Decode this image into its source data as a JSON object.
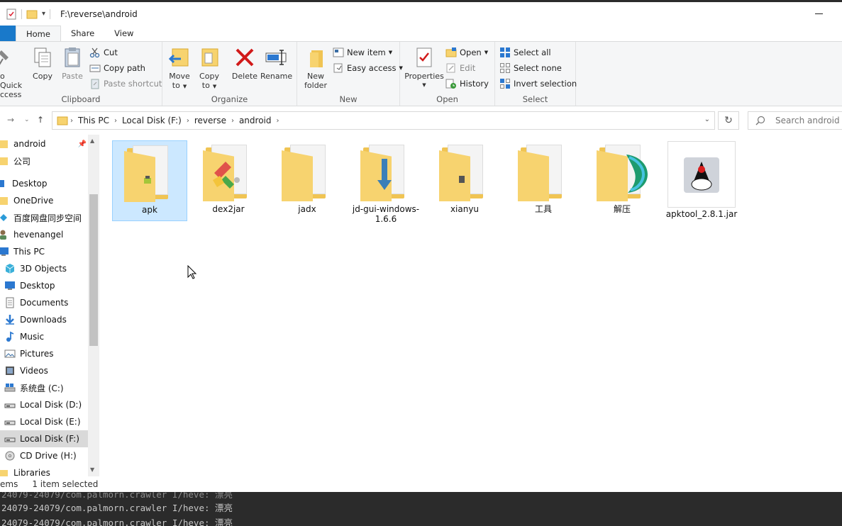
{
  "window": {
    "title": "F:\\reverse\\android"
  },
  "tabs": {
    "home": "Home",
    "share": "Share",
    "view": "View"
  },
  "ribbon": {
    "clipboard": {
      "label": "Clipboard",
      "pin": "o Quick\nccess",
      "pin_line1": "o Quick",
      "pin_line2": "ccess",
      "copy": "Copy",
      "paste": "Paste",
      "cut": "Cut",
      "copy_path": "Copy path",
      "paste_shortcut": "Paste shortcut"
    },
    "organize": {
      "label": "Organize",
      "move_to": "Move",
      "move_to2": "to",
      "copy_to": "Copy",
      "copy_to2": "to",
      "delete": "Delete",
      "rename": "Rename"
    },
    "new": {
      "label": "New",
      "new_folder": "New",
      "new_folder2": "folder",
      "new_item": "New item",
      "easy_access": "Easy access"
    },
    "open": {
      "label": "Open",
      "properties": "Properties",
      "open": "Open",
      "edit": "Edit",
      "history": "History"
    },
    "select": {
      "label": "Select",
      "select_all": "Select all",
      "select_none": "Select none",
      "invert": "Invert selection"
    }
  },
  "address": {
    "crumbs": [
      "This PC",
      "Local Disk (F:)",
      "reverse",
      "android"
    ],
    "search_placeholder": "Search android"
  },
  "nav": [
    {
      "label": "android",
      "icon": "folder-icon",
      "pinned": true
    },
    {
      "label": "公司",
      "icon": "folder-icon"
    },
    {
      "label": "Desktop",
      "icon": "desktop-icon"
    },
    {
      "label": "OneDrive",
      "icon": "folder-icon"
    },
    {
      "label": "百度网盘同步空间",
      "icon": "baidu-icon"
    },
    {
      "label": "hevenangel",
      "icon": "user-icon"
    },
    {
      "label": "This PC",
      "icon": "pc-icon"
    },
    {
      "label": "3D Objects",
      "icon": "cube-icon"
    },
    {
      "label": "Desktop",
      "icon": "desktop-icon"
    },
    {
      "label": "Documents",
      "icon": "documents-icon"
    },
    {
      "label": "Downloads",
      "icon": "downloads-icon"
    },
    {
      "label": "Music",
      "icon": "music-icon"
    },
    {
      "label": "Pictures",
      "icon": "pictures-icon"
    },
    {
      "label": "Videos",
      "icon": "videos-icon"
    },
    {
      "label": "系统盘 (C:)",
      "icon": "drive-icon"
    },
    {
      "label": "Local Disk (D:)",
      "icon": "drive-icon"
    },
    {
      "label": "Local Disk (E:)",
      "icon": "drive-icon"
    },
    {
      "label": "Local Disk (F:)",
      "icon": "drive-icon",
      "selected": true
    },
    {
      "label": "CD Drive (H:)",
      "icon": "cd-icon"
    },
    {
      "label": "Libraries",
      "icon": "folder-icon"
    }
  ],
  "files": [
    {
      "label": "apk",
      "icon": "folder-icon",
      "selected": true
    },
    {
      "label": "dex2jar",
      "icon": "folder-icon"
    },
    {
      "label": "jadx",
      "icon": "folder-icon"
    },
    {
      "label": "jd-gui-windows-1.6.6",
      "label1": "jd-gui-windows-",
      "label2": "1.6.6",
      "icon": "folder-icon"
    },
    {
      "label": "xianyu",
      "icon": "folder-icon"
    },
    {
      "label": "工具",
      "icon": "folder-icon"
    },
    {
      "label": "解压",
      "icon": "folder-icon"
    },
    {
      "label": "apktool_2.8.1.jar",
      "icon": "java-jar-icon"
    }
  ],
  "status": {
    "items": "ems",
    "selected": "1 item selected"
  },
  "terminal": {
    "line1": "24079-24079/com.palmorn.crawler I/heve: 漂亮",
    "line2": "24079-24079/com.palmorn.crawler I/heve: 漂亮"
  },
  "colors": {
    "accent": "#1979ca",
    "folder": "#f7d36f",
    "selection": "#cce8ff",
    "delete_red": "#d11a1a"
  }
}
